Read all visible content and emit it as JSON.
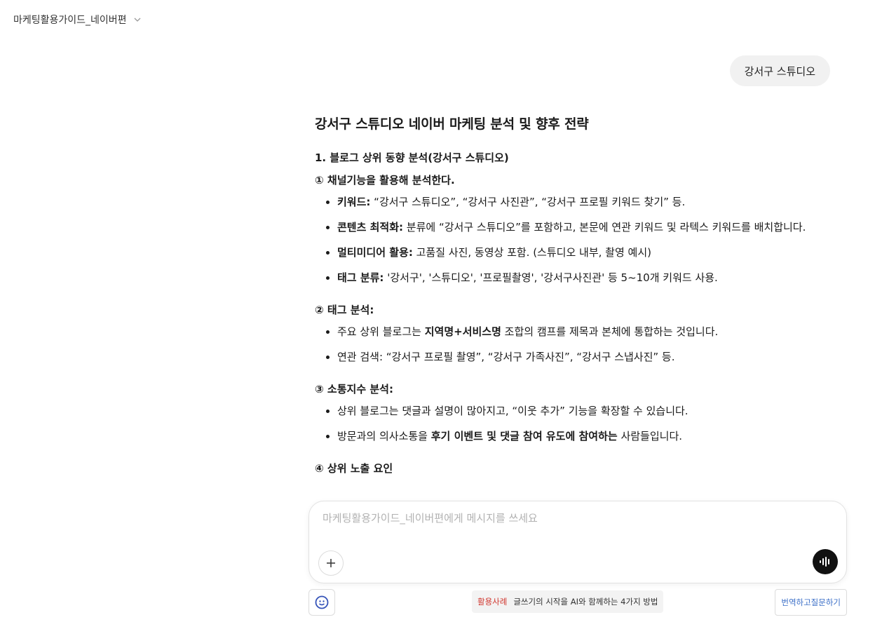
{
  "header": {
    "title": "마케팅활용가이드_네이버편"
  },
  "user_message": "강서구 스튜디오",
  "answer": {
    "title": "강서구 스튜디오 네이버 마케팅 분석 및 향후 전략",
    "section1": "1. 블로그 상위 동향 분석(강서구 스튜디오)",
    "sub1": {
      "title": "① 채널기능을 활용해 분석한다.",
      "items": [
        {
          "bold": "키워드:",
          "text": " “강서구 스튜디오”, “강서구 사진관”, “강서구 프로필 키워드 찾기” 등."
        },
        {
          "bold": "콘텐츠 최적화:",
          "text": " 분류에 “강서구 스튜디오”를 포함하고, 본문에 연관 키워드 및 라텍스 키워드를 배치합니다."
        },
        {
          "bold": "멀티미디어 활용:",
          "text": " 고품질 사진, 동영상 포함. (스튜디오 내부, 촬영 예시)"
        },
        {
          "bold": "태그 분류:",
          "text": " '강서구', '스튜디오', '프로필촬영', '강서구사진관' 등 5~10개 키워드 사용."
        }
      ]
    },
    "sub2": {
      "title": "② 태그 분석:",
      "item1": {
        "pre": "주요 상위 블로그는 ",
        "bold": "지역명+서비스명",
        "post": " 조합의 캠프를 제목과 본체에 통합하는 것입니다."
      },
      "item2": "연관 검색: “강서구 프로필 촬영”, “강서구 가족사진”, “강서구 스냅사진” 등."
    },
    "sub3": {
      "title": "③ 소통지수 분석:",
      "item1": "상위 블로그는 댓글과 설명이 많아지고, “이웃 추가” 기능을 확장할 수 있습니다.",
      "item2": {
        "pre": "방문과의 의사소통을 ",
        "bold": "후기 이벤트 및 댓글 참여 유도에 참여하는",
        "post": " 사람들입니다."
      }
    },
    "sub4": {
      "title": "④ 상위 노출 요인"
    }
  },
  "composer": {
    "placeholder": "마케팅활용가이드_네이버편에게 메시지를 쓰세요",
    "value": ""
  },
  "footer": {
    "tip_tag": "활용사례",
    "tip_text": "글쓰기의 시작을 AI와 함께하는 4가지 방법",
    "translate_label": "번역하고질문하기"
  },
  "icons": {
    "header_dropdown": "chevron-down-icon",
    "attach": "plus-icon",
    "voice": "voice-wave-icon",
    "assistant": "smile-face-icon"
  }
}
